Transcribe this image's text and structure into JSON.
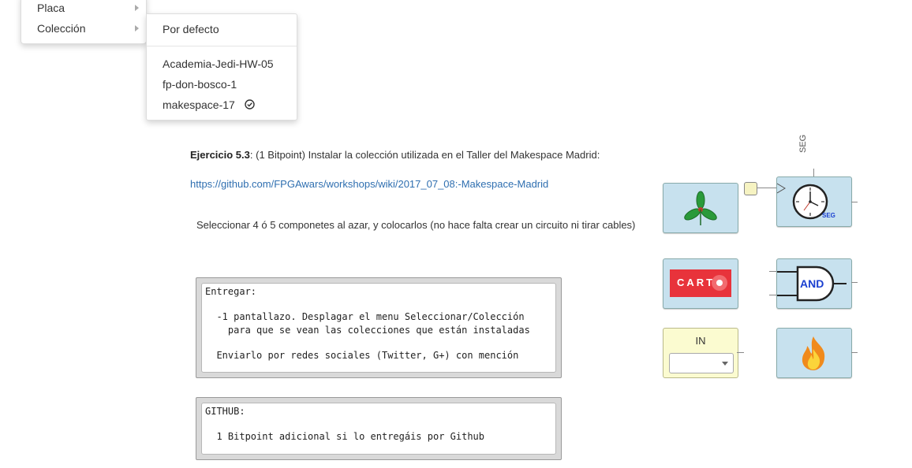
{
  "menu": {
    "items": [
      {
        "label": "Placa"
      },
      {
        "label": "Colección"
      }
    ],
    "submenu": {
      "default_label": "Por defecto",
      "collections": [
        {
          "label": "Academia-Jedi-HW-05",
          "selected": false
        },
        {
          "label": "fp-don-bosco-1",
          "selected": false
        },
        {
          "label": "makespace-17",
          "selected": true
        }
      ]
    }
  },
  "exercise": {
    "title": "Ejercicio 5.3",
    "title_suffix": ": (1 Bitpoint) Instalar la colección utilizada en el Taller del Makespace Madrid:",
    "link": "https://github.com/FPGAwars/workshops/wiki/2017_07_08:-Makespace-Madrid",
    "description": "Seleccionar 4 ó 5 componetes al azar, y colocarlos (no hace falta crear un circuito ni tirar cables)"
  },
  "code_boxes": {
    "entregar": {
      "lines": [
        "Entregar:",
        "",
        "  -1 pantallazo. Desplagar el menu Seleccionar/Colección",
        "    para que se vean las colecciones que están instaladas",
        "",
        "  Enviarlo por redes sociales (Twitter, G+) con mención"
      ]
    },
    "github": {
      "lines": [
        "GITHUB:",
        "",
        "  1 Bitpoint adicional si lo entregáis por Github"
      ]
    }
  },
  "blocks": {
    "seg_label": "SEG",
    "seg_small": "SEG",
    "carto_text": "CART",
    "and_text": "AND",
    "in_label": "IN"
  },
  "colors": {
    "block_bg": "#c7e1ee",
    "in_block_bg": "#fbfbd0",
    "link": "#2f6fb0",
    "carto_red": "#e8333b"
  }
}
